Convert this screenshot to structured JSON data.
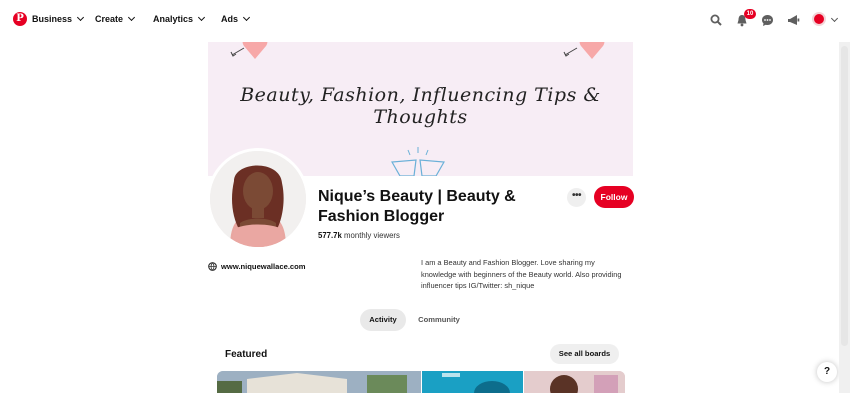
{
  "topnav": {
    "items": [
      {
        "label": "Business"
      },
      {
        "label": "Create"
      },
      {
        "label": "Analytics"
      },
      {
        "label": "Ads"
      }
    ],
    "notification_count": "10",
    "logo_letter": "P",
    "icons": [
      "search-icon",
      "bell-icon",
      "chat-icon",
      "megaphone-icon",
      "account-icon"
    ]
  },
  "cover": {
    "text": "Beauty, Fashion, Influencing Tips & Thoughts"
  },
  "profile": {
    "name": "Nique’s Beauty | Beauty & Fashion Blogger",
    "viewers_count": "577.7k",
    "viewers_label": " monthly viewers",
    "more_label": "•••",
    "follow_label": "Follow",
    "website": "www.niquewallace.com",
    "bio": "I am a Beauty and Fashion Blogger. Love sharing my knowledge with beginners of the Beauty world. Also providing influencer tips IG/Twitter: sh_nique"
  },
  "tabs": [
    {
      "label": "Activity",
      "active": true
    },
    {
      "label": "Community",
      "active": false
    }
  ],
  "featured": {
    "title": "Featured",
    "see_all_label": "See all boards"
  },
  "help_label": "?",
  "colors": {
    "brand": "#e60023",
    "cover_bg": "#f7edf5"
  }
}
